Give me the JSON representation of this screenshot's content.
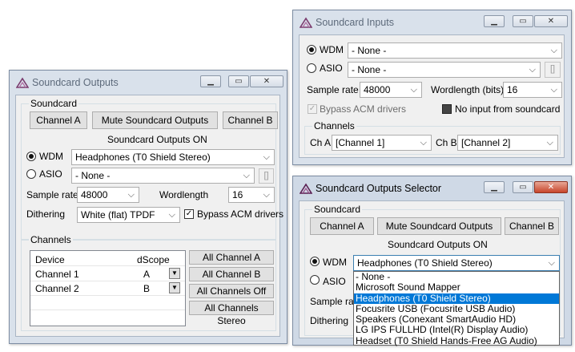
{
  "outputs": {
    "title": "Soundcard Outputs",
    "soundcard_group": "Soundcard",
    "channel_a": "Channel A",
    "mute": "Mute Soundcard Outputs",
    "channel_b": "Channel B",
    "status": "Soundcard Outputs ON",
    "wdm_label": "WDM",
    "wdm_value": "Headphones (T0 Shield Stereo)",
    "asio_label": "ASIO",
    "asio_value": "- None -",
    "asio_btn": "[]",
    "sample_rate_label": "Sample rate",
    "sample_rate_value": "48000",
    "wordlength_label": "Wordlength",
    "wordlength_value": "16",
    "dithering_label": "Dithering",
    "dithering_value": "White (flat) TPDF",
    "bypass_label": "Bypass ACM drivers",
    "channels_group": "Channels",
    "col_device": "Device",
    "col_dscope": "dScope",
    "rows": [
      {
        "device": "Channel 1",
        "dscope": "A"
      },
      {
        "device": "Channel 2",
        "dscope": "B"
      }
    ],
    "all_a": "All Channel A",
    "all_b": "All Channel B",
    "all_off": "All Channels Off",
    "all_stereo": "All Channels Stereo"
  },
  "inputs": {
    "title": "Soundcard Inputs",
    "wdm_label": "WDM",
    "wdm_value": "- None -",
    "asio_label": "ASIO",
    "asio_value": "- None -",
    "asio_btn": "[]",
    "sample_rate_label": "Sample rate",
    "sample_rate_value": "48000",
    "wordlength_label": "Wordlength (bits)",
    "wordlength_value": "16",
    "bypass_label": "Bypass ACM drivers",
    "no_input_label": "No input from soundcard",
    "channels_group": "Channels",
    "cha_label": "Ch A",
    "cha_value": "[Channel 1]",
    "chb_label": "Ch B",
    "chb_value": "[Channel 2]"
  },
  "selector": {
    "title": "Soundcard Outputs Selector",
    "soundcard_group": "Soundcard",
    "channel_a": "Channel A",
    "mute": "Mute Soundcard Outputs",
    "channel_b": "Channel B",
    "status": "Soundcard Outputs ON",
    "wdm_label": "WDM",
    "wdm_value": "Headphones (T0 Shield Stereo)",
    "asio_label": "ASIO",
    "sample_rate_label": "Sample rate",
    "dithering_label": "Dithering",
    "dropdown_options": [
      "- None -",
      "Microsoft Sound Mapper",
      "Headphones (T0 Shield Stereo)",
      "Focusrite USB (Focusrite USB Audio)",
      "Speakers (Conexant SmartAudio HD)",
      "LG IPS FULLHD (Intel(R) Display Audio)",
      "Headset (T0 Shield Hands-Free AG Audio)"
    ],
    "selected_index": 2
  },
  "icons": {
    "app_icon": "dscope-logo-icon",
    "minimize": "minimize-icon",
    "maximize": "maximize-icon",
    "close": "close-icon"
  },
  "colors": {
    "selection": "#0078d7",
    "close_active": "#c7452b"
  }
}
